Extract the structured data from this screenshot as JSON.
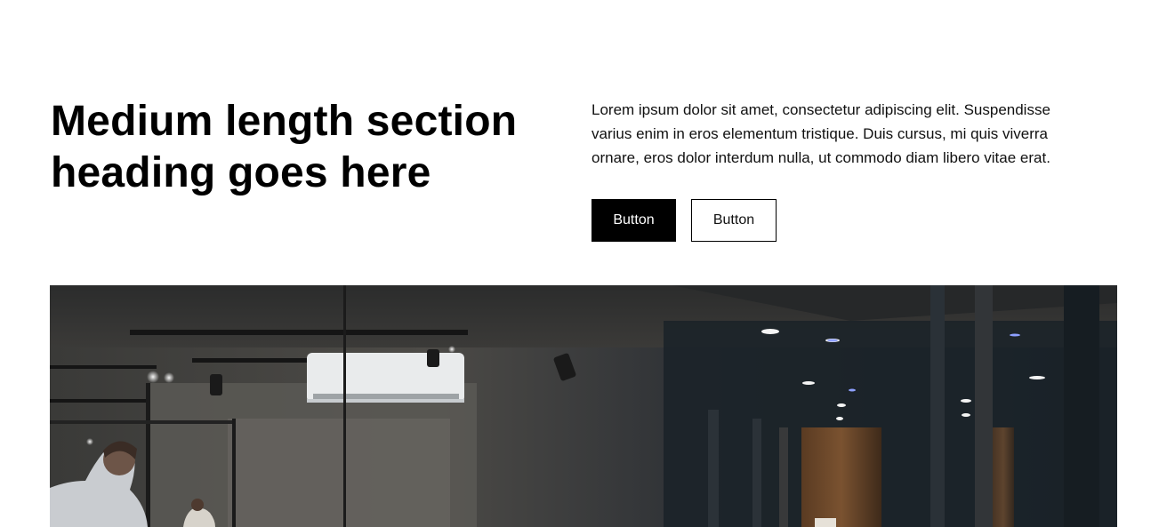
{
  "section": {
    "heading_line1": "Medium length section",
    "heading_line2": "heading goes here",
    "body": "Lorem ipsum dolor sit amet, consectetur adipiscing elit. Suspendisse varius enim in eros elementum tristique. Duis cursus, mi quis viverra ornare, eros dolor interdum nulla, ut commodo diam libero vitae erat.",
    "primary_button_label": "Button",
    "secondary_button_label": "Button"
  },
  "hero_image": {
    "subject": "office-interior-photo"
  },
  "colors": {
    "background": "#ffffff",
    "text": "#000000",
    "primary_button_bg": "#000000",
    "primary_button_text": "#ffffff",
    "secondary_button_border": "#000000"
  }
}
